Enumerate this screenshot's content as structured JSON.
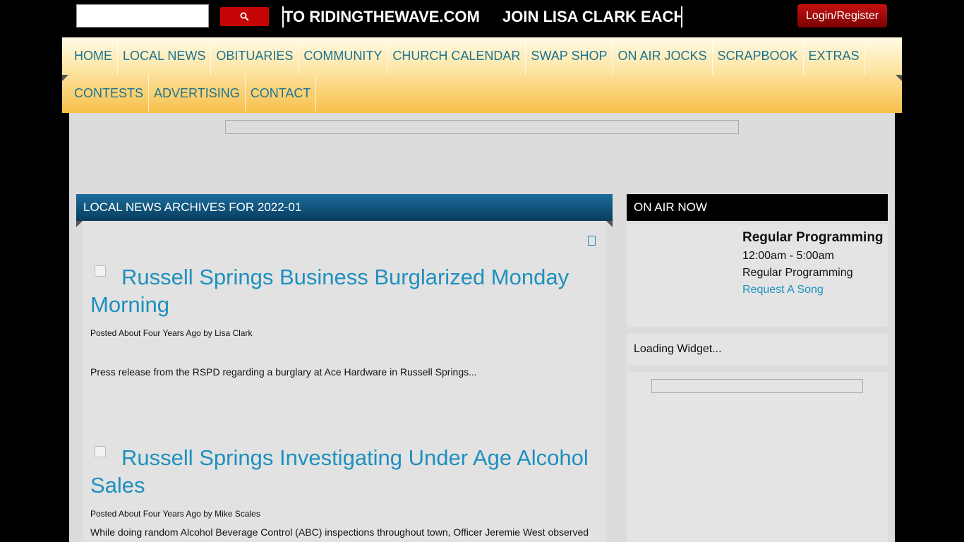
{
  "header": {
    "search": {
      "value": "",
      "placeholder": ""
    },
    "search_button_icon": "search-icon",
    "ticker_items": [
      "TO RIDINGTHEWAVE.COM",
      "JOIN LISA CLARK EACH"
    ],
    "login_label": "Login/Register"
  },
  "nav": {
    "row1": [
      "HOME",
      "LOCAL NEWS",
      "OBITUARIES",
      "COMMUNITY",
      "CHURCH CALENDAR",
      "SWAP SHOP",
      "ON AIR JOCKS",
      "SCRAPBOOK",
      "EXTRAS"
    ],
    "row2": [
      "CONTESTS",
      "ADVERTISING",
      "CONTACT"
    ]
  },
  "main": {
    "section_title": "LOCAL NEWS ARCHIVES FOR 2022-01",
    "posts": [
      {
        "title": "Russell Springs Business Burglarized Monday Morning",
        "meta": "Posted About Four Years Ago by Lisa Clark",
        "excerpt": "Press release from the RSPD regarding a burglary at Ace Hardware in Russell Springs..."
      },
      {
        "title": "Russell Springs Investigating Under Age Alcohol Sales",
        "meta": "Posted About Four Years Ago by Mike Scales",
        "excerpt": "While doing random Alcohol Beverage Control (ABC) inspections throughout town, Officer Jeremie West observed"
      }
    ]
  },
  "sidebar": {
    "title": "ON AIR NOW",
    "show_name": "Regular Programming",
    "show_time": "12:00am - 5:00am",
    "show_host": "Regular Programming",
    "request_link": "Request A Song",
    "widget_text": "Loading Widget..."
  },
  "colors": {
    "link": "#1e90bf",
    "nav_text": "#1e7391",
    "header_blue": "#0b4a72",
    "search_red": "#c50505",
    "login_red": "#a00808"
  }
}
